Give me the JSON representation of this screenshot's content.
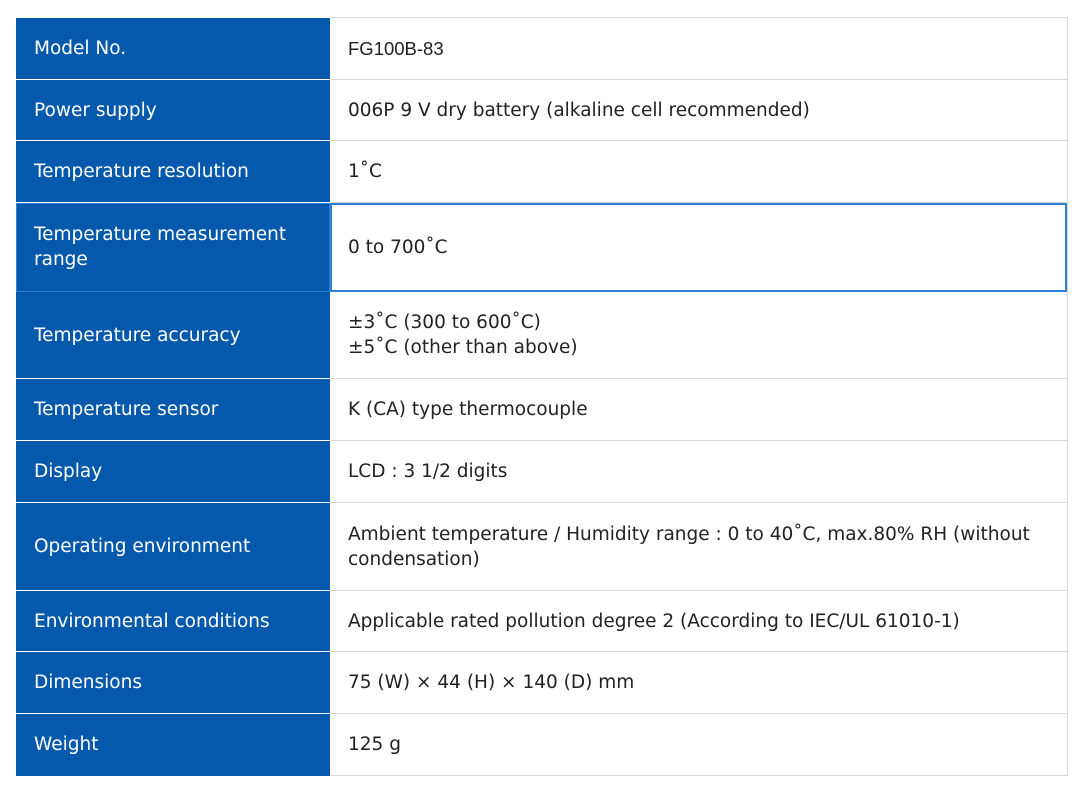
{
  "colors": {
    "header_bg": "#0459ad",
    "header_text": "#ffffff",
    "value_text": "#222222",
    "border": "#d9d9d9",
    "highlight": "#2b7fd8"
  },
  "specs": {
    "model": {
      "label": "Model No.",
      "value": "FG100B-83"
    },
    "power": {
      "label": "Power supply",
      "value": "006P 9 V dry battery (alkaline cell recommended)"
    },
    "resolution": {
      "label": "Temperature resolution",
      "value": "1˚C"
    },
    "range": {
      "label": "Temperature measurement range",
      "value": "0 to 700˚C"
    },
    "accuracy": {
      "label": "Temperature accuracy",
      "value_line1": "±3˚C (300 to 600˚C)",
      "value_line2": "±5˚C (other than above)"
    },
    "sensor": {
      "label": "Temperature sensor",
      "value": "K (CA) type thermocouple"
    },
    "display": {
      "label": "Display",
      "value": "LCD : 3 1/2 digits"
    },
    "operating": {
      "label": "Operating environment",
      "value": "Ambient temperature / Humidity range : 0 to 40˚C, max.80% RH (without condensation)"
    },
    "environmental": {
      "label": "Environmental conditions",
      "value": "Applicable rated pollution degree 2 (According to IEC/UL 61010-1)"
    },
    "dimensions": {
      "label": "Dimensions",
      "value": "75 (W) × 44 (H) × 140 (D) mm"
    },
    "weight": {
      "label": "Weight",
      "value": "125 g"
    }
  }
}
